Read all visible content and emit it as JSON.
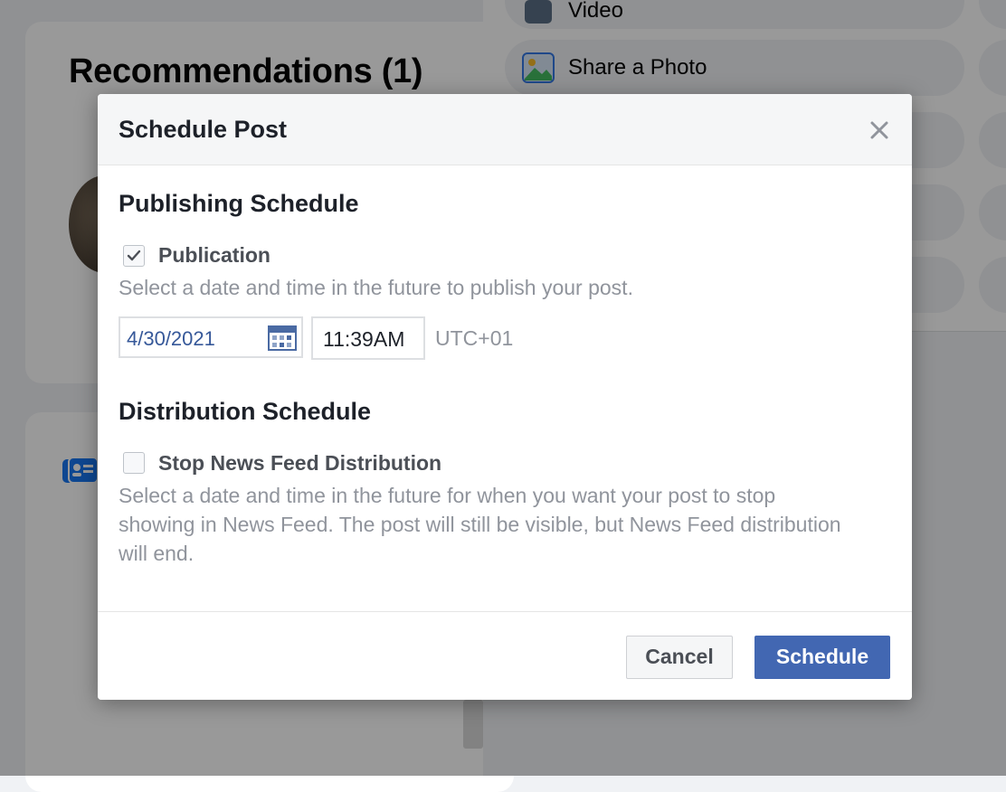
{
  "background": {
    "recommendations_title": "Recommendations (1)",
    "composer_items": [
      {
        "label": "Video",
        "icon": "video-icon"
      },
      {
        "label": "Share a Photo",
        "icon": "photo-icon"
      }
    ]
  },
  "modal": {
    "title": "Schedule Post",
    "close_icon": "close-icon",
    "publishing": {
      "section_title": "Publishing Schedule",
      "checkbox_label": "Publication",
      "checked": true,
      "help_text": "Select a date and time in the future to publish your post.",
      "date_value": "4/30/2021",
      "time_value": "11:39AM",
      "timezone": "UTC+01"
    },
    "distribution": {
      "section_title": "Distribution Schedule",
      "checkbox_label": "Stop News Feed Distribution",
      "checked": false,
      "help_text": "Select a date and time in the future for when you want your post to stop showing in News Feed. The post will still be visible, but News Feed distribution will end."
    },
    "buttons": {
      "cancel": "Cancel",
      "schedule": "Schedule"
    }
  },
  "colors": {
    "primary": "#4267b2",
    "link": "#365899",
    "muted": "#90949c"
  }
}
